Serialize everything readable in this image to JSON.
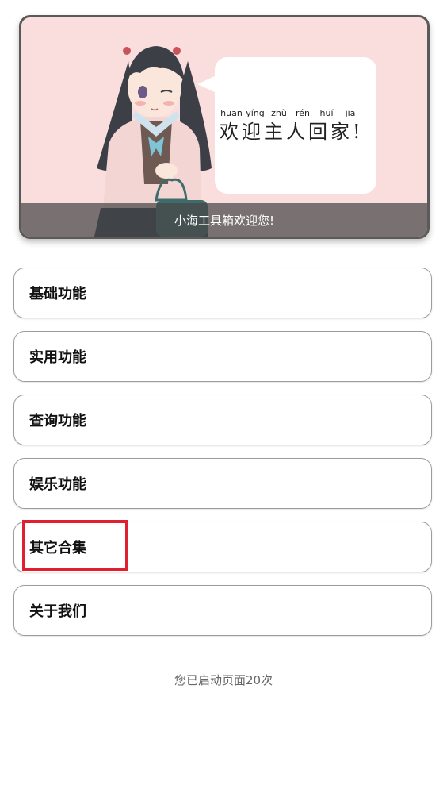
{
  "banner": {
    "pinyin": [
      "huān",
      "yíng",
      "zhǔ",
      "rén",
      "huí",
      "jiā"
    ],
    "greeting": "欢迎主人回家!",
    "caption": "小海工具箱欢迎您!"
  },
  "menu": {
    "items": [
      {
        "label": "基础功能"
      },
      {
        "label": "实用功能"
      },
      {
        "label": "查询功能"
      },
      {
        "label": "娱乐功能"
      },
      {
        "label": "其它合集"
      },
      {
        "label": "关于我们"
      }
    ]
  },
  "footer": {
    "launch_count_text": "您已启动页面20次"
  },
  "colors": {
    "highlight": "#e02030",
    "banner_bg": "#fadede"
  }
}
